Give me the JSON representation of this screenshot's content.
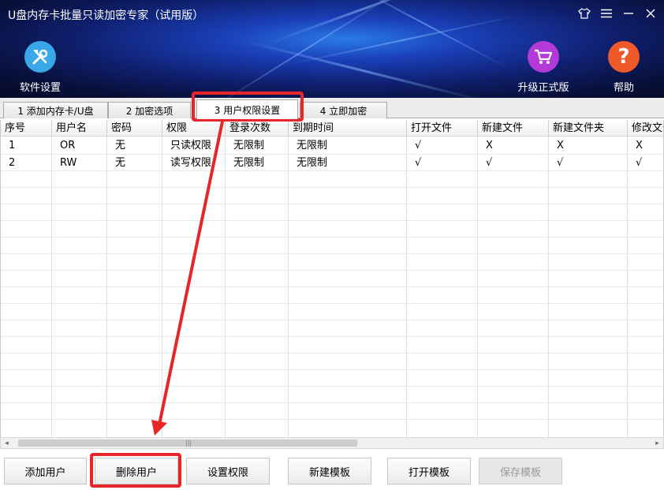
{
  "app": {
    "title": "U盘内存卡批量只读加密专家（试用版）"
  },
  "header": {
    "settings_label": "软件设置",
    "upgrade_label": "升级正式版",
    "help_label": "帮助",
    "help_glyph": "?",
    "colors": {
      "settings": "#3aa8e8",
      "upgrade": "#b33ad8",
      "help": "#f05a2a"
    }
  },
  "tabs": [
    {
      "label": "1 添加内存卡/U盘"
    },
    {
      "label": "2 加密选项"
    },
    {
      "label": "3 用户权限设置"
    },
    {
      "label": "4 立即加密"
    }
  ],
  "table": {
    "headers": [
      "序号",
      "用户名",
      "密码",
      "权限",
      "登录次数",
      "到期时间",
      "打开文件",
      "新建文件",
      "新建文件夹",
      "修改文件"
    ],
    "rows": [
      [
        "1",
        "OR",
        "无",
        "只读权限",
        "无限制",
        "无限制",
        "√",
        "X",
        "X",
        "X"
      ],
      [
        "2",
        "RW",
        "无",
        "读写权限",
        "无限制",
        "无限制",
        "√",
        "√",
        "√",
        "√"
      ]
    ]
  },
  "scrollbar": {
    "left_arrow": "◂",
    "right_arrow": "▸",
    "grip": "|||"
  },
  "buttons": {
    "add_user": "添加用户",
    "delete_user": "删除用户",
    "set_permission": "设置权限",
    "new_template": "新建模板",
    "open_template": "打开模板",
    "save_template": "保存模板"
  },
  "annotation_color": "#e8262a"
}
